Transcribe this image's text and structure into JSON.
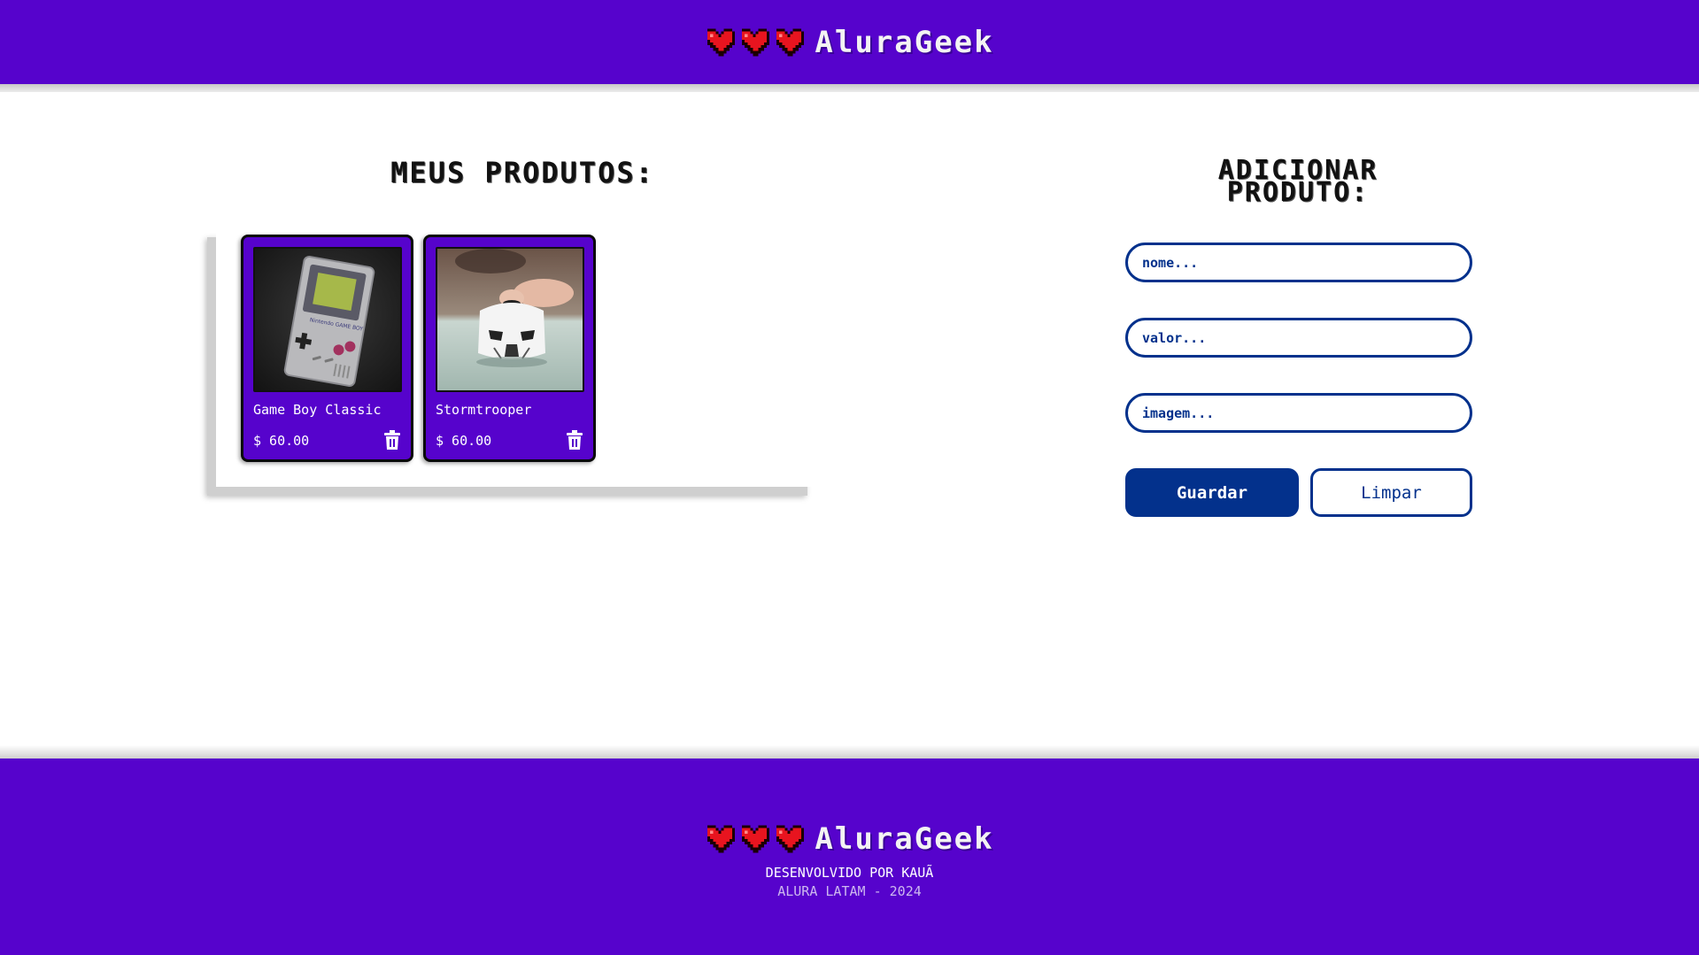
{
  "header": {
    "brand": "AluraGeek",
    "logo_icon": "pixel-heart-icon",
    "hearts": 3
  },
  "products": {
    "title": "MEUS PRODUTOS:",
    "items": [
      {
        "name": "Game Boy Classic",
        "price": "$ 60.00",
        "image": "game-boy-image",
        "delete_icon": "trash-icon"
      },
      {
        "name": "Stormtrooper",
        "price": "$ 60.00",
        "image": "stormtrooper-image",
        "delete_icon": "trash-icon"
      }
    ]
  },
  "form": {
    "title_line1": "ADICIONAR",
    "title_line2": "PRODUTO:",
    "name_placeholder": "nome...",
    "value_placeholder": "valor...",
    "image_placeholder": "imagem...",
    "save_label": "Guardar",
    "clear_label": "Limpar"
  },
  "footer": {
    "brand": "AluraGeek",
    "developed_by": "DESENVOLVIDO POR KAUÃ",
    "copyright": "ALURA LATAM - 2024"
  },
  "colors": {
    "primary": "#5603cc",
    "accent": "#03318c",
    "text_dark": "#111111"
  }
}
